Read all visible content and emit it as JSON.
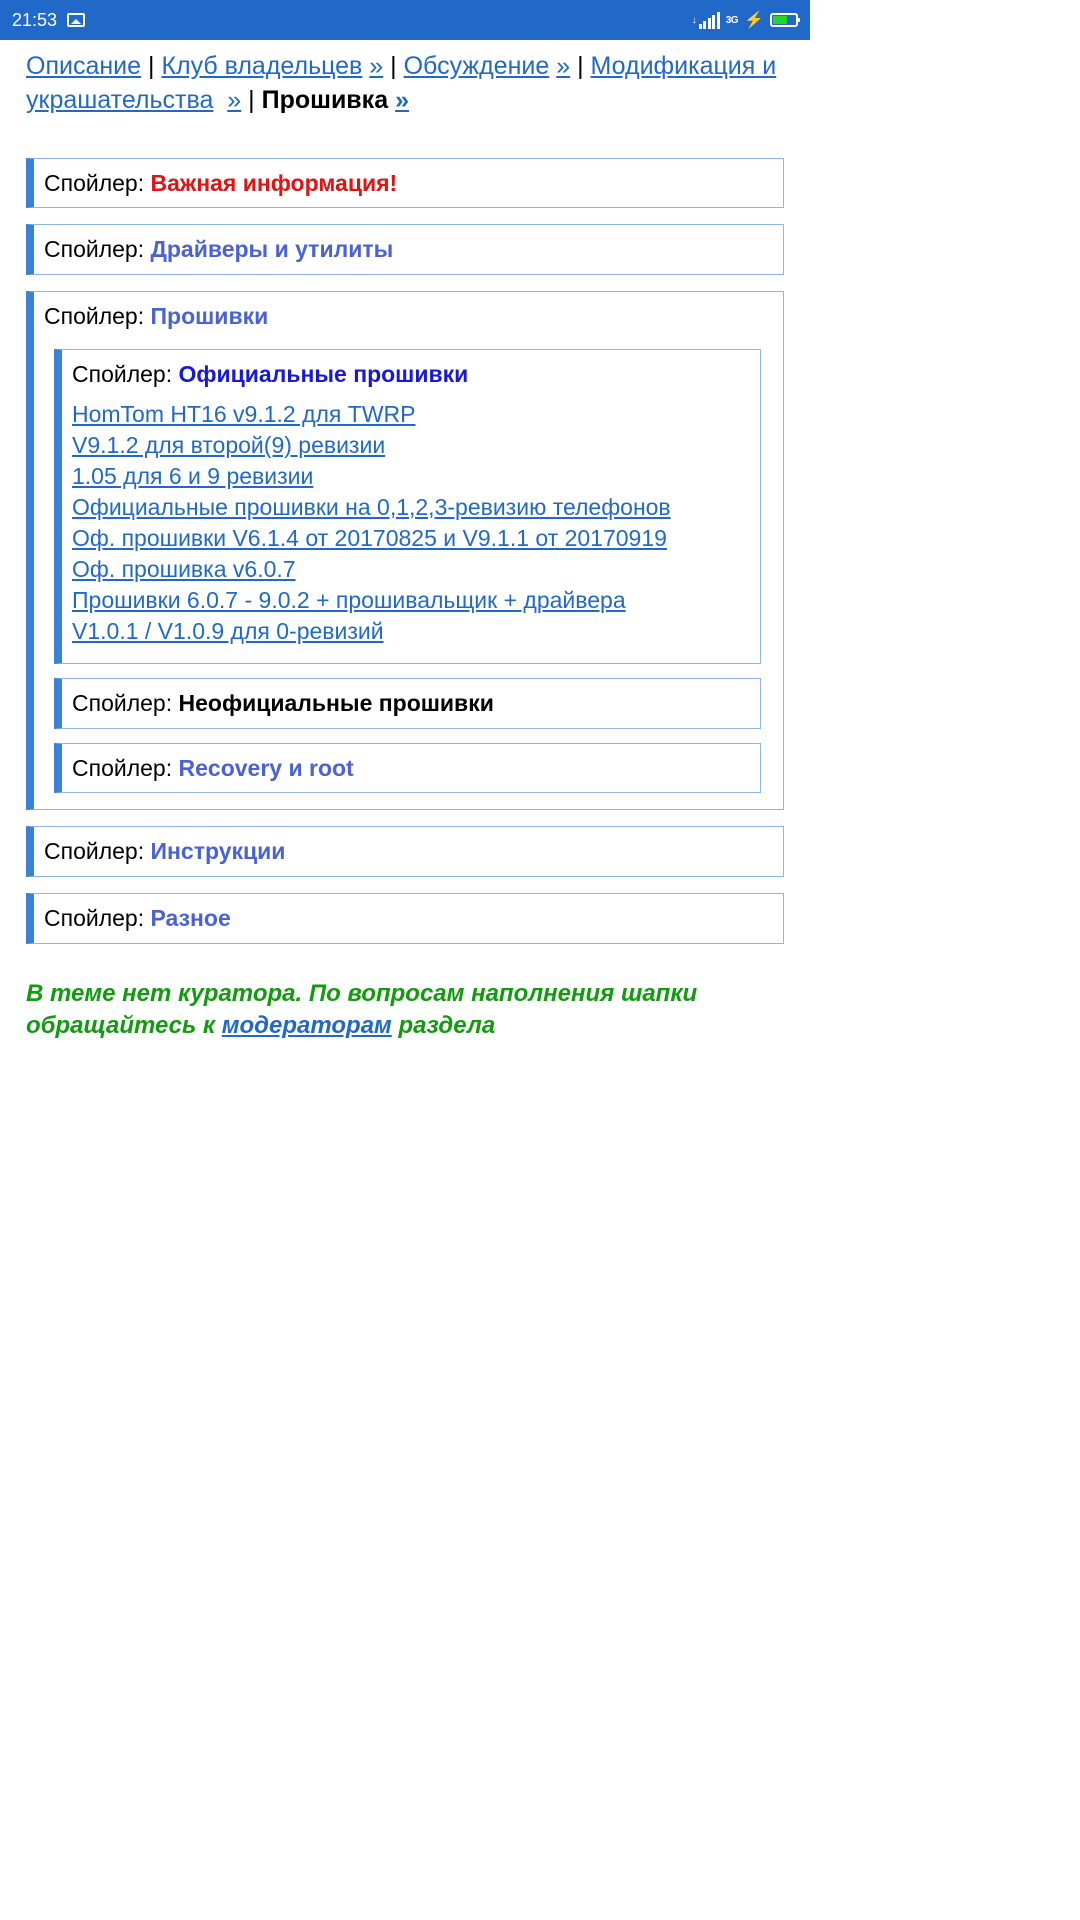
{
  "status": {
    "time": "21:53",
    "network": "3G"
  },
  "breadcrumbs": {
    "items": [
      {
        "label": "Описание",
        "chevron": false
      },
      {
        "label": "Клуб владельцев",
        "chevron": true
      },
      {
        "label": "Обсуждение",
        "chevron": true
      },
      {
        "label": "Модификация и украшательства",
        "chevron": true
      }
    ],
    "current": "Прошивка",
    "chevron": "»",
    "sep": " | "
  },
  "spoiler_label": "Спойлер: ",
  "spoilers": {
    "important": "Важная информация!",
    "drivers": "Драйверы и утилиты",
    "firmware": "Прошивки",
    "official": "Официальные прошивки",
    "unofficial": "Неофициальные прошивки",
    "recovery": "Recovery и root",
    "instructions": "Инструкции",
    "misc": "Разное"
  },
  "official_links": [
    "HomTom HT16 v9.1.2 для TWRP",
    "V9.1.2 для второй(9) ревизии",
    "1.05 для 6 и 9 ревизии",
    "Официальные прошивки на 0,1,2,3-ревизию телефонов",
    "Оф. прошивки V6.1.4 от 20170825 и V9.1.1 от 20170919",
    "Оф. прошивка v6.0.7",
    "Прошивки 6.0.7 - 9.0.2 + прошивальщик + драйвера",
    "V1.0.1 / V1.0.9 для 0-ревизий"
  ],
  "footer": {
    "part1": "В теме нет куратора. По вопросам наполнения шапки обращайтесь к ",
    "moderators": "модераторам",
    "part2": " раздела"
  }
}
